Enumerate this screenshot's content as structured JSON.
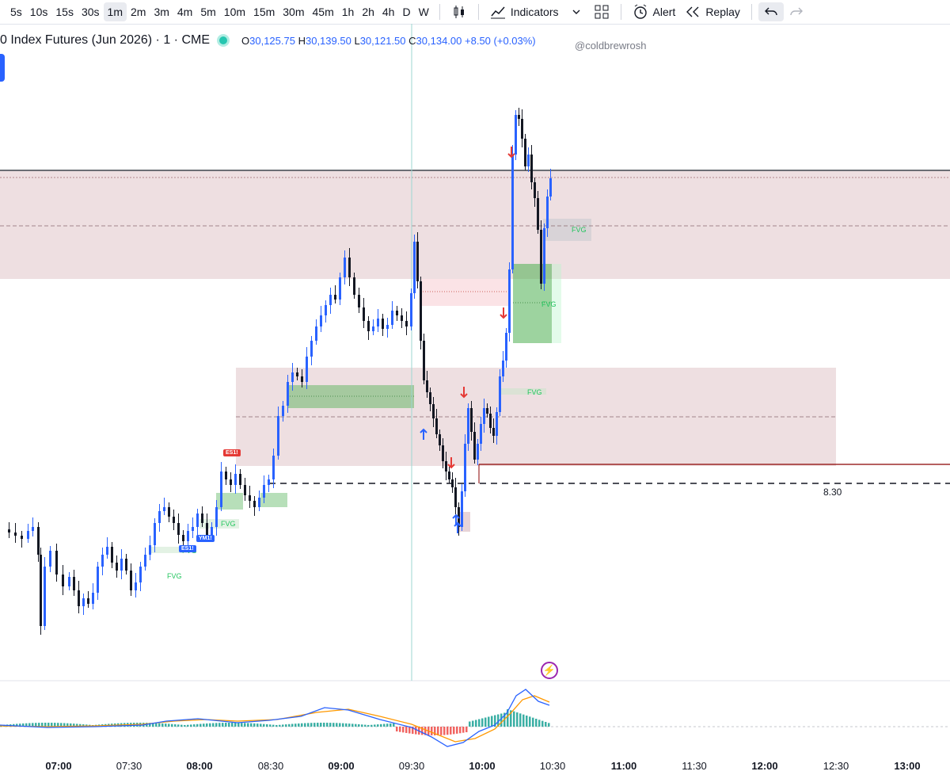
{
  "toolbar": {
    "timeframes": [
      "5s",
      "10s",
      "15s",
      "30s",
      "1m",
      "2m",
      "3m",
      "4m",
      "5m",
      "10m",
      "15m",
      "30m",
      "45m",
      "1h",
      "2h",
      "4h",
      "D",
      "W"
    ],
    "active_timeframe": "1m",
    "indicators_label": "Indicators",
    "alert_label": "Alert",
    "replay_label": "Replay"
  },
  "legend": {
    "symbol": "0 Index Futures (Jun 2026) · 1 · CME",
    "open_key": "O",
    "open": "30,125.75",
    "high_key": "H",
    "high": "30,139.50",
    "low_key": "L",
    "low": "30,121.50",
    "close_key": "C",
    "close": "30,134.00",
    "change": "+8.50 (+0.03%)"
  },
  "watermark": "@coldbrewrosh",
  "price_label": "8.30",
  "fvg_label": "FVG",
  "markers": {
    "es1": "ES1!",
    "ym1": "YM1!"
  },
  "time_axis": [
    {
      "label": "07:00",
      "major": true
    },
    {
      "label": "07:30",
      "major": false
    },
    {
      "label": "08:00",
      "major": true
    },
    {
      "label": "08:30",
      "major": false
    },
    {
      "label": "09:00",
      "major": true
    },
    {
      "label": "09:30",
      "major": false
    },
    {
      "label": "10:00",
      "major": true
    },
    {
      "label": "10:30",
      "major": false
    },
    {
      "label": "11:00",
      "major": true
    },
    {
      "label": "11:30",
      "major": false
    },
    {
      "label": "12:00",
      "major": true
    },
    {
      "label": "12:30",
      "major": false
    },
    {
      "label": "13:00",
      "major": true
    }
  ],
  "colors": {
    "up_body": "#2962ff",
    "down_body": "#131722",
    "zone_red": "#d9b8bd",
    "zone_green": "#4caf50",
    "macd_line": "#2962ff",
    "signal_line": "#ff9800",
    "hist_up": "#26a69a",
    "hist_down": "#ef5350"
  }
}
